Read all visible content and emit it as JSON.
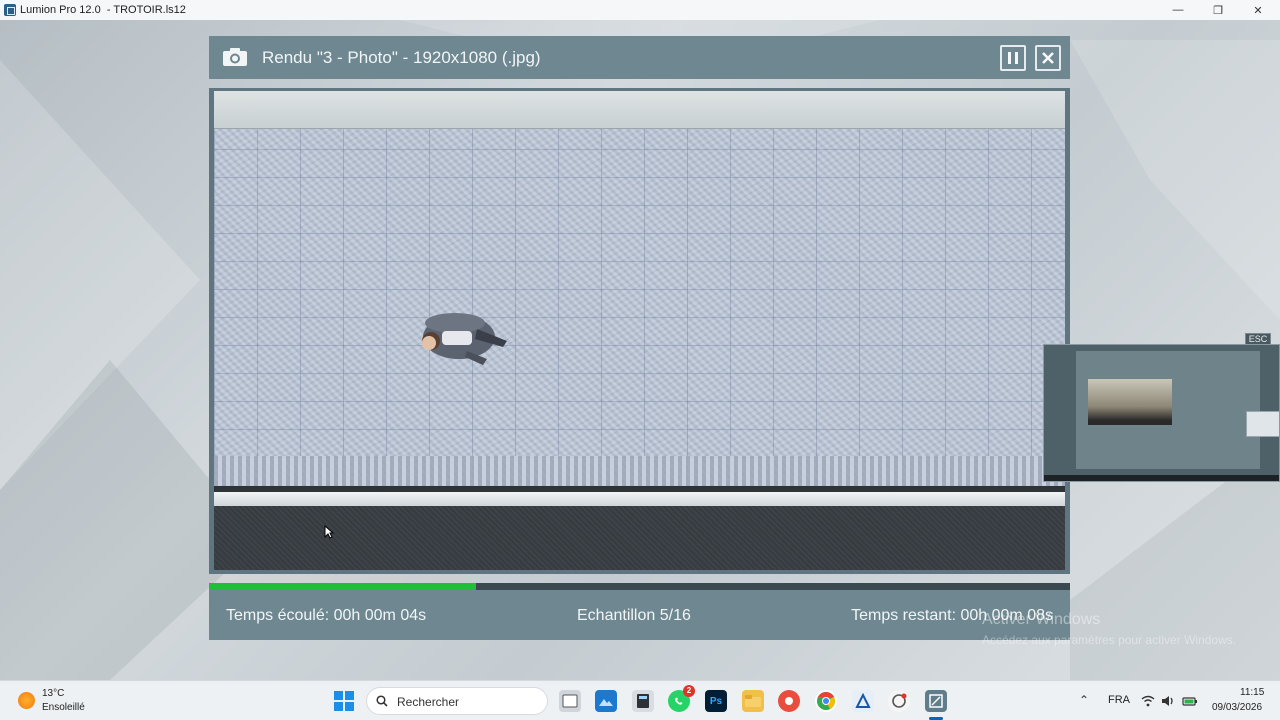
{
  "window": {
    "title": "Lumion Pro 12.0  - TROTOIR.ls12",
    "controls": {
      "minimize": "—",
      "maximize": "❐",
      "close": "✕"
    }
  },
  "render": {
    "title": "Rendu \"3 - Photo\" - 1920x1080 (.jpg)",
    "pause_icon": "pause-icon",
    "close_icon": "close-icon",
    "camera_icon": "camera-icon",
    "progress_fraction": 0.31,
    "progress_color": "#1fbf36",
    "elapsed": "Temps écoulé: 00h 00m 04s",
    "sample": "Echantillon 5/16",
    "remaining": "Temps restant: 00h 00m 08s"
  },
  "preview": {
    "esc_label": "ESC"
  },
  "watermark": {
    "line1": "Activer Windows",
    "line2": "Accédez aux paramètres pour activer Windows."
  },
  "taskbar": {
    "weather": {
      "temp": "13°C",
      "desc": "Ensoleillé"
    },
    "search_placeholder": "Rechercher",
    "whatsapp_badge": "2",
    "language": "FRA",
    "time": "11:15",
    "date": "09/03/2026"
  }
}
